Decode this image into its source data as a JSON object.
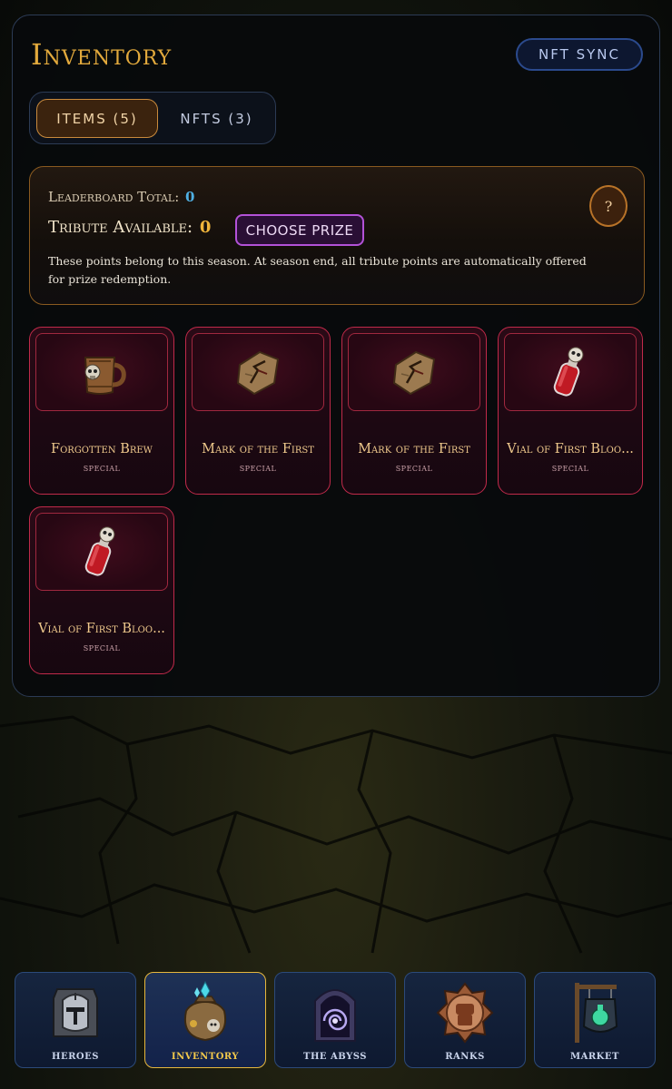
{
  "header": {
    "title": "Inventory",
    "nft_sync_label": "NFT SYNC"
  },
  "tabs": [
    {
      "label": "ITEMS (5)",
      "active": true
    },
    {
      "label": "NFTS (3)",
      "active": false
    }
  ],
  "points": {
    "leaderboard_label": "Leaderboard Total:",
    "leaderboard_value": "0",
    "tribute_label": "Tribute Available:",
    "tribute_value": "0",
    "choose_prize_label": "CHOOSE PRIZE",
    "description": "These points belong to this season. At season end, all tribute points are automatically offered for prize redemption.",
    "help_label": "?"
  },
  "items": [
    {
      "name": "Forgotten Brew",
      "rarity": "special",
      "icon": "skull-mug-icon"
    },
    {
      "name": "Mark of the First",
      "rarity": "special",
      "icon": "parchment-mark-icon"
    },
    {
      "name": "Mark of the First",
      "rarity": "special",
      "icon": "parchment-mark-icon"
    },
    {
      "name": "Vial of First Bloo...",
      "rarity": "special",
      "icon": "blood-vial-icon"
    },
    {
      "name": "Vial of First Bloo...",
      "rarity": "special",
      "icon": "blood-vial-icon"
    }
  ],
  "nav": [
    {
      "label": "HEROES",
      "icon": "helmet-icon",
      "active": false
    },
    {
      "label": "INVENTORY",
      "icon": "loot-bag-icon",
      "active": true
    },
    {
      "label": "THE ABYSS",
      "icon": "portal-icon",
      "active": false
    },
    {
      "label": "RANKS",
      "icon": "fist-emblem-icon",
      "active": false
    },
    {
      "label": "MARKET",
      "icon": "shop-sign-icon",
      "active": false
    }
  ],
  "colors": {
    "accent_gold": "#e2a93c",
    "item_border": "#c02a4a",
    "leaderboard_value": "#4fb0e4",
    "tribute_value": "#f0b53b",
    "prize_button": "#b352d8"
  }
}
